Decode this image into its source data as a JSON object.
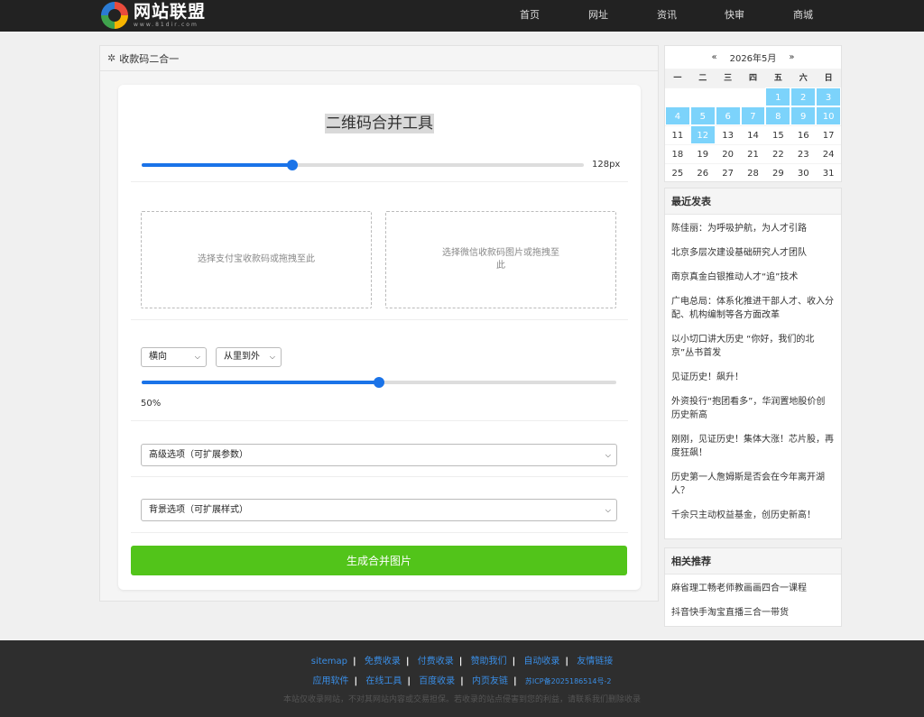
{
  "site": {
    "name": "网站联盟",
    "domain": "www.81dir.com"
  },
  "nav": [
    "首页",
    "网址",
    "资讯",
    "快审",
    "商城"
  ],
  "panel": {
    "title": "收款码二合一"
  },
  "tool": {
    "title": "二维码合并工具",
    "size_value": 128,
    "size_label": "128px",
    "size_fraction": 0.34,
    "drop_alipay": "选择支付宝收款码或拖拽至此",
    "drop_wechat": "选择微信收款码图片或拖拽至此",
    "direction": "横向",
    "order": "从里到外",
    "ratio_fraction": 0.5,
    "ratio_label": "50%",
    "advanced": "高级选项（可扩展参数）",
    "background": "背景选项（可扩展样式）",
    "generate": "生成合并图片"
  },
  "calendar": {
    "prev": "«",
    "next": "»",
    "month": "2026年5月",
    "weekdays": [
      "一",
      "二",
      "三",
      "四",
      "五",
      "六",
      "日"
    ],
    "first_weekday_index": 4,
    "days_in_month": 31,
    "post_days": [
      1,
      2,
      3,
      4,
      5,
      6,
      7,
      8,
      9,
      10,
      12
    ]
  },
  "recent": {
    "title": "最近发表",
    "items": [
      "陈佳丽：为呼吸护航，为人才引路",
      "北京多层次建设基础研究人才团队",
      "南京真金白银推动人才“追”技术",
      "广电总局：体系化推进干部人才、收入分配、机构编制等各方面改革",
      "以小切口讲大历史 “你好，我们的北京”丛书首发",
      "见证历史！飙升！",
      "外资投行“抱团看多”，华润置地股价创历史新高",
      "刚刚，见证历史！集体大涨！芯片股，再度狂飙！",
      "历史第一人詹姆斯是否会在今年离开湖人？",
      "千余只主动权益基金，创历史新高！"
    ]
  },
  "related": {
    "title": "相关推荐",
    "items": [
      "麻省理工畅老师教画画四合一课程",
      "抖音快手淘宝直播三合一带货"
    ]
  },
  "footer": {
    "row1": [
      "sitemap",
      "免费收录",
      "付费收录",
      "赞助我们",
      "自动收录",
      "友情链接"
    ],
    "row2": [
      "应用软件",
      "在线工具",
      "百度收录",
      "内页友链"
    ],
    "icp": "苏ICP备2025186514号-2",
    "note": "本站仅收录网站，不对其网站内容或交易担保。若收录的站点侵害到您的利益，请联系我们删除收录"
  }
}
